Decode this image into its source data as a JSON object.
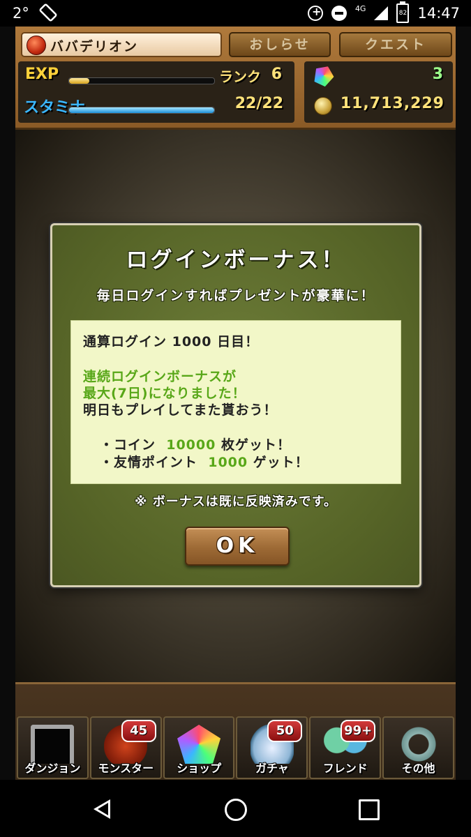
{
  "status_bar": {
    "temperature": "2°",
    "network": "4G",
    "battery": "82",
    "time": "14:47"
  },
  "hud": {
    "player_name": "ババデリオン",
    "news_button": "おしらせ",
    "quest_button": "クエスト",
    "exp_label": "EXP",
    "exp_progress_percent": 14,
    "rank_label": "ランク",
    "rank_value": "6",
    "stamina_label": "スタミナ",
    "stamina_value": "22/22",
    "stamina_progress_percent": 100,
    "magic_stones": "3",
    "coins": "11,713,229"
  },
  "dialog": {
    "title": "ログインボーナス！",
    "subtitle": "毎日ログインすればプレゼントが豪華に！",
    "line1": "通算ログイン 1000 日目！",
    "line2": "連続ログインボーナスが",
    "line3": "最大(7日)になりました！",
    "line4": "明日もプレイしてまた貰おう！",
    "reward_coin_prefix": "・コイン  ",
    "reward_coin_amount": "10000",
    "reward_coin_suffix": " 枚ゲット！",
    "reward_friend_prefix": "・友情ポイント  ",
    "reward_friend_amount": "1000",
    "reward_friend_suffix": " ゲット！",
    "note": "※ ボーナスは既に反映済みです。",
    "ok_button": "OK"
  },
  "menu": {
    "items": [
      {
        "label": "ダンジョン",
        "badge": ""
      },
      {
        "label": "モンスター",
        "badge": "45"
      },
      {
        "label": "ショップ",
        "badge": ""
      },
      {
        "label": "ガチャ",
        "badge": "50"
      },
      {
        "label": "フレンド",
        "badge": "99+"
      },
      {
        "label": "その他",
        "badge": ""
      }
    ]
  },
  "icons": {
    "rotate": "screen-rotation-icon",
    "sync": "data-saver-icon",
    "dnd": "do-not-disturb-icon",
    "signal": "signal-icon",
    "battery": "battery-icon",
    "stone": "magic-stone-icon",
    "coin": "coin-icon"
  },
  "colors": {
    "exp_label": "#ffd23a",
    "stamina_label": "#3ab6ff",
    "highlight_green": "#58a718",
    "dialog_bg": "#566427",
    "badge_red": "#d23a3a"
  }
}
